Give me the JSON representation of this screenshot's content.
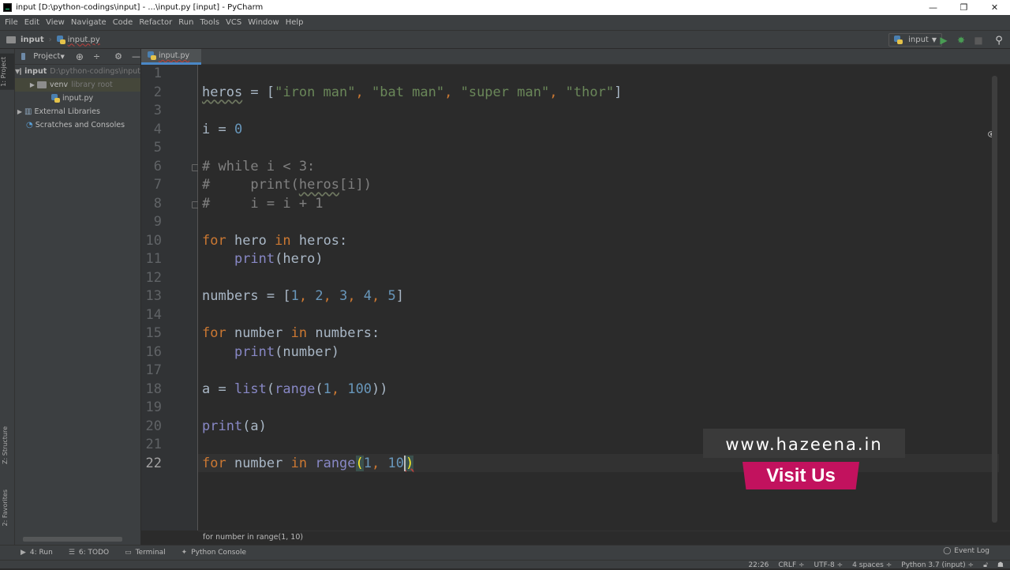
{
  "window": {
    "title": "input [D:\\python-codings\\input] - ...\\input.py [input] - PyCharm",
    "controls": {
      "minimize": "—",
      "maximize": "❐",
      "close": "✕"
    }
  },
  "menu": [
    "File",
    "Edit",
    "View",
    "Navigate",
    "Code",
    "Refactor",
    "Run",
    "Tools",
    "VCS",
    "Window",
    "Help"
  ],
  "navbar": {
    "breadcrumb": [
      "input",
      "input.py"
    ],
    "run_config": "input",
    "icons": [
      "run-icon",
      "debug-icon",
      "stop-icon",
      "search-icon"
    ]
  },
  "left_strip": {
    "project_tab": "1: Project",
    "structure_tab": "Z: Structure",
    "favorites_tab": "2: Favorites"
  },
  "project_panel": {
    "header": "Project",
    "tree": [
      {
        "label": "input",
        "hint": "D:\\python-codings\\input",
        "type": "folder",
        "expanded": true,
        "level": 0
      },
      {
        "label": "venv",
        "hint": "library root",
        "type": "folder",
        "expanded": false,
        "level": 1
      },
      {
        "label": "input.py",
        "hint": "",
        "type": "python-file",
        "level": 1
      },
      {
        "label": "External Libraries",
        "hint": "",
        "type": "libraries",
        "expanded": false,
        "level": 0
      },
      {
        "label": "Scratches and Consoles",
        "hint": "",
        "type": "scratches",
        "level": 0
      }
    ]
  },
  "editor": {
    "tab": "input.py",
    "current_line": 22,
    "line_numbers": [
      "1",
      "2",
      "3",
      "4",
      "5",
      "6",
      "7",
      "8",
      "9",
      "10",
      "11",
      "12",
      "13",
      "14",
      "15",
      "16",
      "17",
      "18",
      "19",
      "20",
      "21",
      "22"
    ],
    "code": [
      "",
      "heros = [\"iron man\", \"bat man\", \"super man\", \"thor\"]",
      "",
      "i = 0",
      "",
      "# while i < 3:",
      "#     print(heros[i])",
      "#     i = i + 1",
      "",
      "for hero in heros:",
      "    print(hero)",
      "",
      "numbers = [1, 2, 3, 4, 5]",
      "",
      "for number in numbers:",
      "    print(number)",
      "",
      "a = list(range(1, 100))",
      "",
      "print(a)",
      "",
      "for number in range(1, 10)"
    ],
    "breadcrumb": "for number in range(1, 10)"
  },
  "overlay": {
    "url": "www.hazeena.in",
    "cta": "Visit Us",
    "accent": "#c2125e"
  },
  "tool_windows": [
    {
      "label": "4: Run",
      "icon": "run-icon"
    },
    {
      "label": "6: TODO",
      "icon": "todo-icon"
    },
    {
      "label": "Terminal",
      "icon": "terminal-icon"
    },
    {
      "label": "Python Console",
      "icon": "python-console-icon"
    }
  ],
  "event_log": "Event Log",
  "status": {
    "position": "22:26",
    "line_sep": "CRLF ÷",
    "encoding": "UTF-8 ÷",
    "indent": "4 spaces ÷",
    "interpreter": "Python 3.7 (input) ÷"
  }
}
